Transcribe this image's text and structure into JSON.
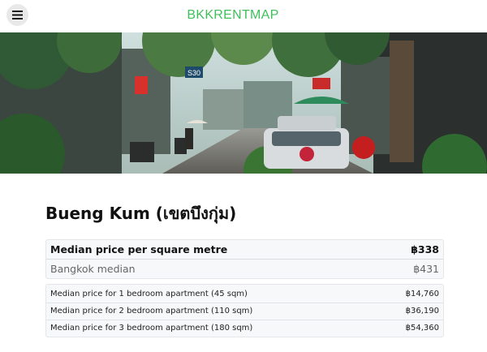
{
  "header": {
    "brand": "BKKRENTMAP"
  },
  "hero": {
    "sign_1": "S30"
  },
  "district": {
    "title": "Bueng Kum (เขตบึงกุ่ม)"
  },
  "summary": {
    "median_label": "Median price per square metre",
    "median_value": "฿338",
    "bangkok_label": "Bangkok median",
    "bangkok_value": "฿431"
  },
  "apartments": [
    {
      "label": "Median price for 1 bedroom apartment (45 sqm)",
      "value": "฿14,760"
    },
    {
      "label": "Median price for 2 bedroom apartment (110 sqm)",
      "value": "฿36,190"
    },
    {
      "label": "Median price for 3 bedroom apartment (180 sqm)",
      "value": "฿54,360"
    }
  ],
  "colors": {
    "brand": "#3fbf5a"
  }
}
